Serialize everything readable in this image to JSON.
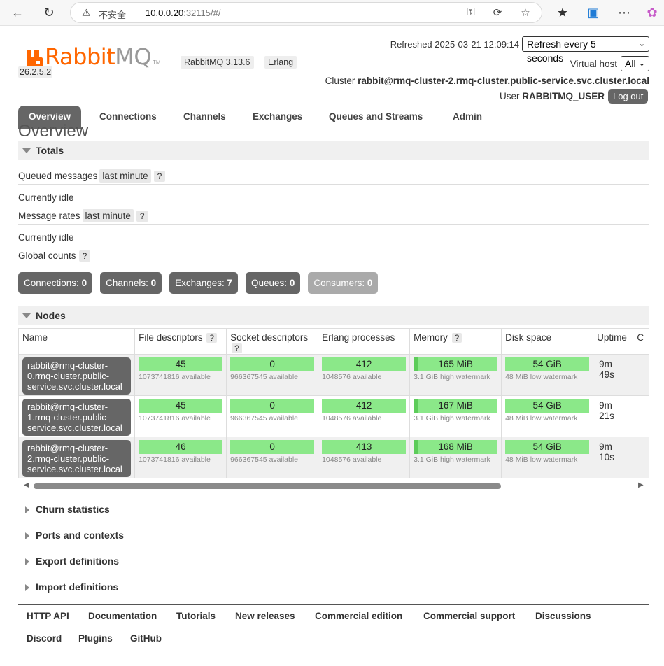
{
  "browser": {
    "insecure_label": "不安全",
    "url_host": "10.0.0.20",
    "url_rest": ":32115/#/"
  },
  "header": {
    "logo_rabbit": "Rabbit",
    "logo_mq": "MQ",
    "logo_tm": "TM",
    "version": "RabbitMQ 3.13.6",
    "erlang_label": "Erlang",
    "erlang_version": "26.2.5.2",
    "refreshed": "Refreshed 2025-03-21 12:09:14",
    "refresh_select": "Refresh every 5 seconds",
    "vhost_label": "Virtual host",
    "vhost_select": "All",
    "cluster_label": "Cluster",
    "cluster_name": "rabbit@rmq-cluster-2.rmq-cluster.public-service.svc.cluster.local",
    "user_label": "User",
    "user_name": "RABBITMQ_USER",
    "logout": "Log out"
  },
  "tabs": [
    "Overview",
    "Connections",
    "Channels",
    "Exchanges",
    "Queues and Streams",
    "Admin"
  ],
  "page_title": "Overview",
  "totals": {
    "title": "Totals",
    "queued_label": "Queued messages",
    "queued_range": "last minute",
    "help": "?",
    "idle1": "Currently idle",
    "rates_label": "Message rates",
    "rates_range": "last minute",
    "idle2": "Currently idle",
    "global_label": "Global counts"
  },
  "counts": [
    {
      "label": "Connections:",
      "value": "0"
    },
    {
      "label": "Channels:",
      "value": "0"
    },
    {
      "label": "Exchanges:",
      "value": "7"
    },
    {
      "label": "Queues:",
      "value": "0"
    },
    {
      "label": "Consumers:",
      "value": "0"
    }
  ],
  "nodes": {
    "title": "Nodes",
    "columns": [
      "Name",
      "File descriptors",
      "Socket descriptors",
      "Erlang processes",
      "Memory",
      "Disk space",
      "Uptime",
      "C"
    ],
    "rows": [
      {
        "name": "rabbit@rmq-cluster-0.rmq-cluster.public-service.svc.cluster.local",
        "name_lines": [
          "rabbit@rmq-cluster-",
          "0.rmq-cluster.public-",
          "service.svc.cluster.local"
        ],
        "fd": "45",
        "fd_sub": "1073741816 available",
        "sd": "0",
        "sd_sub": "966367545 available",
        "ep": "412",
        "ep_sub": "1048576 available",
        "mem": "165 MiB",
        "mem_sub": "3.1 GiB high watermark",
        "disk": "54 GiB",
        "disk_sub": "48 MiB low watermark",
        "uptime": "9m 49s"
      },
      {
        "name": "rabbit@rmq-cluster-1.rmq-cluster.public-service.svc.cluster.local",
        "name_lines": [
          "rabbit@rmq-cluster-",
          "1.rmq-cluster.public-",
          "service.svc.cluster.local"
        ],
        "fd": "45",
        "fd_sub": "1073741816 available",
        "sd": "0",
        "sd_sub": "966367545 available",
        "ep": "412",
        "ep_sub": "1048576 available",
        "mem": "167 MiB",
        "mem_sub": "3.1 GiB high watermark",
        "disk": "54 GiB",
        "disk_sub": "48 MiB low watermark",
        "uptime": "9m 21s"
      },
      {
        "name": "rabbit@rmq-cluster-2.rmq-cluster.public-service.svc.cluster.local",
        "name_lines": [
          "rabbit@rmq-cluster-",
          "2.rmq-cluster.public-",
          "service.svc.cluster.local"
        ],
        "fd": "46",
        "fd_sub": "1073741816 available",
        "sd": "0",
        "sd_sub": "966367545 available",
        "ep": "413",
        "ep_sub": "1048576 available",
        "mem": "168 MiB",
        "mem_sub": "3.1 GiB high watermark",
        "disk": "54 GiB",
        "disk_sub": "48 MiB low watermark",
        "uptime": "9m 10s"
      }
    ]
  },
  "sections": [
    "Churn statistics",
    "Ports and contexts",
    "Export definitions",
    "Import definitions"
  ],
  "footer": [
    "HTTP API",
    "Documentation",
    "Tutorials",
    "New releases",
    "Commercial edition",
    "Commercial support",
    "Discussions",
    "Discord",
    "Plugins",
    "GitHub"
  ]
}
